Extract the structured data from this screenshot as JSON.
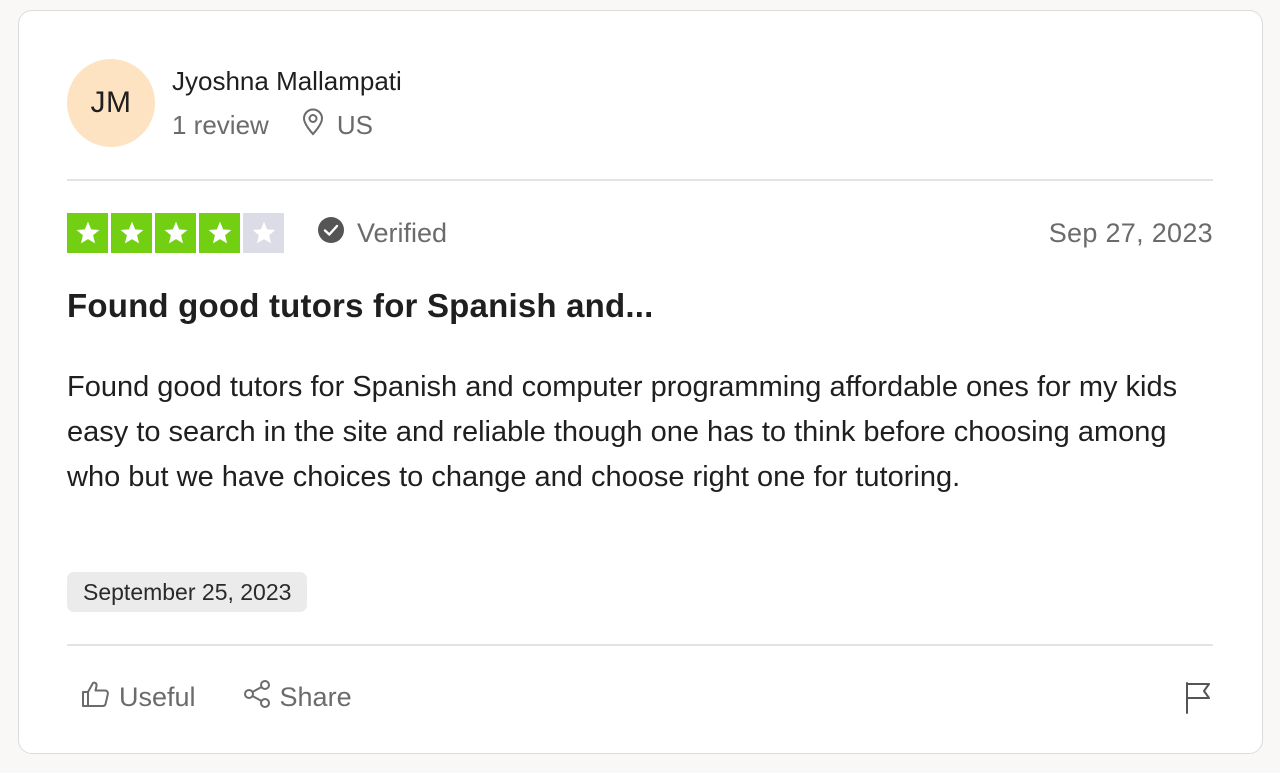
{
  "reviewer": {
    "initials": "JM",
    "name": "Jyoshna Mallampati",
    "review_count": "1 review",
    "location": "US",
    "avatar_color": "#fde3c1"
  },
  "rating": {
    "stars": 4,
    "max_stars": 5,
    "star_color": "#73cf11",
    "empty_color": "#dcdce6"
  },
  "verified_label": "Verified",
  "review_date": "Sep 27, 2023",
  "review": {
    "title": "Found good tutors for Spanish and...",
    "body": "Found good tutors for Spanish and computer programming affordable ones for my kids easy to search in the site and reliable though one has to think before choosing among who but we have choices to change and choose right one for tutoring.",
    "experience_date": "September 25, 2023"
  },
  "actions": {
    "useful_label": "Useful",
    "share_label": "Share"
  },
  "icons": {
    "location": "location-pin-icon",
    "verified": "check-circle-icon",
    "useful": "thumbs-up-icon",
    "share": "share-icon",
    "report": "flag-icon"
  }
}
